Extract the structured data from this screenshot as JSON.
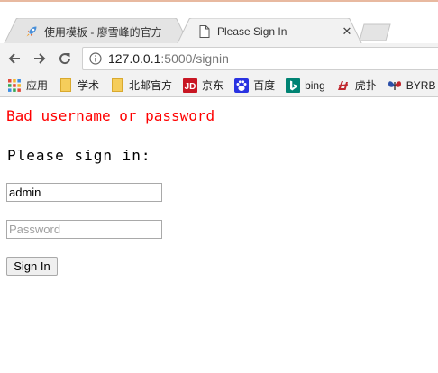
{
  "browser": {
    "tabs": [
      {
        "title": "使用模板 - 廖雪峰的官方",
        "icon": "rocket-icon",
        "active": false
      },
      {
        "title": "Please Sign In",
        "icon": "page-icon",
        "active": true
      }
    ],
    "close_glyph": "✕",
    "address": {
      "host": "127.0.0.1",
      "rest": ":5000/signin"
    },
    "bookmarks": [
      {
        "label": "应用",
        "icon": "apps-grid-icon"
      },
      {
        "label": "学术",
        "icon": "folder-icon"
      },
      {
        "label": "北邮官方",
        "icon": "folder-icon"
      },
      {
        "label": "京东",
        "icon": "jd-icon"
      },
      {
        "label": "百度",
        "icon": "baidu-icon"
      },
      {
        "label": "bing",
        "icon": "bing-icon"
      },
      {
        "label": "虎扑",
        "icon": "hupu-icon"
      },
      {
        "label": "BYRB",
        "icon": "byr-icon"
      }
    ]
  },
  "page": {
    "flash_message": "Bad username or password",
    "heading": "Please sign in:",
    "username_value": "admin",
    "password_placeholder": "Password",
    "submit_label": "Sign In"
  },
  "colors": {
    "flash": "#ff0000",
    "toolbar_bg": "#f2f2f2",
    "folder": "#f5cd5b"
  }
}
